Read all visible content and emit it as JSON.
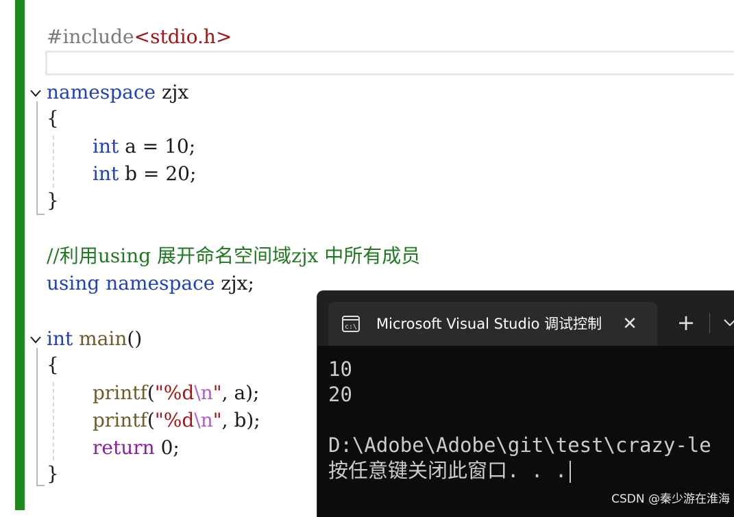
{
  "editor": {
    "lines": {
      "include_directive": "#include",
      "include_header": "<stdio.h>",
      "ns_keyword": "namespace",
      "ns_name": " zjx",
      "open_brace1": "{",
      "int_a_kw": "int",
      "int_a_rest": " a = 10;",
      "int_b_kw": "int",
      "int_b_rest": " b = 20;",
      "close_brace1": "}",
      "comment": "//利用using 展开命名空间域zjx 中所有成员",
      "using_kw": "using",
      "using_ns_kw": " namespace",
      "using_rest": " zjx;",
      "main_kw": "int",
      "main_fn": " main",
      "main_parens": "()",
      "open_brace2": "{",
      "printf1_fn": "printf",
      "printf1_open": "(",
      "printf1_str1": "\"%d",
      "printf1_esc": "\\n",
      "printf1_str2": "\"",
      "printf1_rest": ", a);",
      "printf2_fn": "printf",
      "printf2_open": "(",
      "printf2_str1": "\"%d",
      "printf2_esc": "\\n",
      "printf2_str2": "\"",
      "printf2_rest": ", b);",
      "return_kw": "return",
      "return_rest": " 0;",
      "close_brace2": "}"
    }
  },
  "console": {
    "tab_title": "Microsoft Visual Studio 调试控制台",
    "icon": "console-icon",
    "close_glyph": "✕",
    "new_tab_glyph": "+",
    "output_line1": "10",
    "output_line2": "20",
    "path_line": "D:\\Adobe\\Adobe\\git\\test\\crazy-le",
    "prompt_line": "按任意键关闭此窗口. . ."
  },
  "watermark": "CSDN @秦少游在淮海"
}
